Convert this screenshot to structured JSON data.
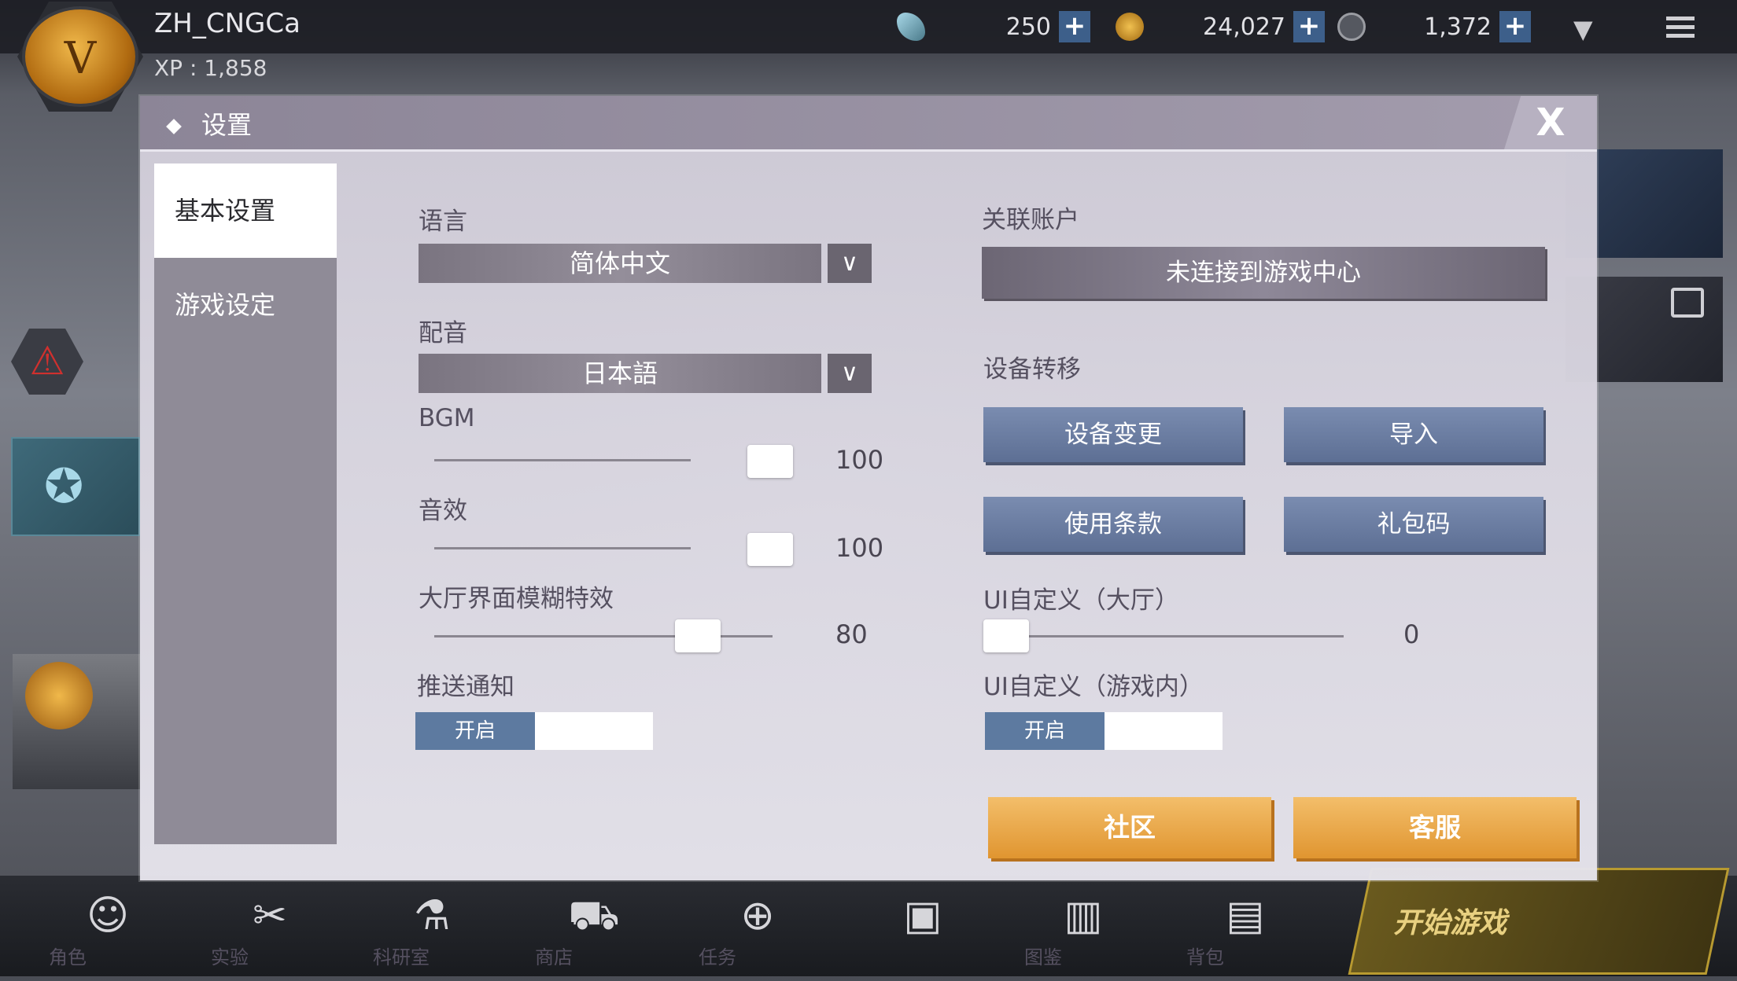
{
  "player": {
    "name": "ZH_CNGCa",
    "xp": "XP : 1,858"
  },
  "resources": [
    {
      "icon": "feather-gem-icon",
      "value": "250"
    },
    {
      "icon": "gold-coin-icon",
      "value": "24,027"
    },
    {
      "icon": "bp-paw-icon",
      "value": "1,372"
    }
  ],
  "modal": {
    "title": "设置",
    "close": "X"
  },
  "tabs": [
    {
      "label": "基本设置",
      "active": true
    },
    {
      "label": "游戏设定",
      "active": false
    }
  ],
  "settings": {
    "language": {
      "label": "语言",
      "value": "简体中文"
    },
    "voice": {
      "label": "配音",
      "value": "日本語"
    },
    "bgm": {
      "label": "BGM",
      "value": "100",
      "level": 1.0
    },
    "sfx": {
      "label": "音效",
      "value": "100",
      "level": 1.0
    },
    "blur": {
      "label": "大厅界面模糊特效",
      "value": "80",
      "level": 0.8
    },
    "push": {
      "label": "推送通知",
      "state": "开启"
    },
    "account": {
      "label": "关联账户",
      "button": "未连接到游戏中心"
    },
    "transfer": {
      "label": "设备转移"
    },
    "buttons": {
      "device_change": "设备变更",
      "import": "导入",
      "terms": "使用条款",
      "gift_code": "礼包码"
    },
    "ui_lobby": {
      "label": "UI自定义（大厅）",
      "value": "0",
      "level": 0.0
    },
    "ui_ingame": {
      "label": "UI自定义（游戏内）",
      "state": "开启"
    },
    "community": "社区",
    "support": "客服"
  },
  "bottom_nav": [
    {
      "label": "角色",
      "icon": "character-icon"
    },
    {
      "label": "实验",
      "icon": "experiment-weapons-icon"
    },
    {
      "label": "科研室",
      "icon": "flask-icon"
    },
    {
      "label": "商店",
      "icon": "cart-icon"
    },
    {
      "label": "任务",
      "icon": "target-icon"
    },
    {
      "label": "",
      "icon": "lock-icon"
    },
    {
      "label": "图鉴",
      "icon": "books-icon"
    },
    {
      "label": "背包",
      "icon": "backpack-icon"
    }
  ],
  "start_game": "开始游戏",
  "colors": {
    "accent_blue": "#5d7aa0",
    "accent_orange": "#e09530",
    "modal_header": "#9a93a5"
  }
}
